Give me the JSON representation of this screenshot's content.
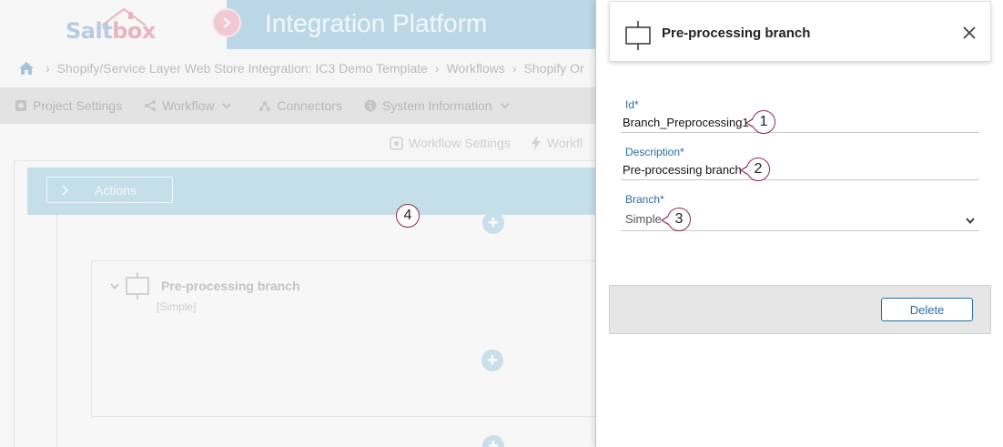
{
  "app": {
    "logo_text_a": "Salt",
    "logo_text_b": "box",
    "title": "Integration Platform"
  },
  "breadcrumb": {
    "items": [
      "Shopify/Service Layer Web Store Integration: IC3 Demo Template",
      "Workflows",
      "Shopify Or"
    ]
  },
  "toolbar": {
    "project_settings": "Project Settings",
    "workflow": "Workflow",
    "connectors": "Connectors",
    "system_information": "System Information"
  },
  "subbar": {
    "workflow_settings": "Workflow Settings",
    "workflow_truncated": "Workfl"
  },
  "canvas": {
    "actions_label": "Actions",
    "branch_name": "Pre-processing branch",
    "branch_type": "[Simple]"
  },
  "panel": {
    "title": "Pre-processing branch",
    "id_label": "Id*",
    "id_value": "Branch_Preprocessing1",
    "description_label": "Description*",
    "description_value": "Pre-processing branch",
    "branch_label": "Branch*",
    "branch_value": "Simple",
    "delete_label": "Delete"
  },
  "callouts": {
    "c1": "1",
    "c2": "2",
    "c3": "3",
    "c4": "4"
  },
  "colors": {
    "title_band": "#bcd8e6",
    "accent": "#2a6e9e",
    "callout_border": "#8b2a4a"
  }
}
